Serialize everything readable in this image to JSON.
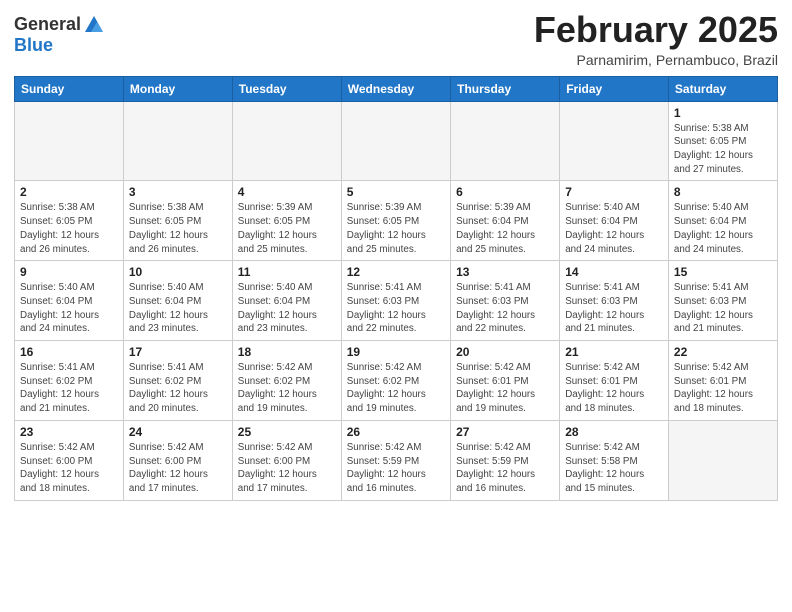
{
  "header": {
    "logo_general": "General",
    "logo_blue": "Blue",
    "month_year": "February 2025",
    "location": "Parnamirim, Pernambuco, Brazil"
  },
  "days_of_week": [
    "Sunday",
    "Monday",
    "Tuesday",
    "Wednesday",
    "Thursday",
    "Friday",
    "Saturday"
  ],
  "weeks": [
    [
      {
        "day": "",
        "info": ""
      },
      {
        "day": "",
        "info": ""
      },
      {
        "day": "",
        "info": ""
      },
      {
        "day": "",
        "info": ""
      },
      {
        "day": "",
        "info": ""
      },
      {
        "day": "",
        "info": ""
      },
      {
        "day": "1",
        "info": "Sunrise: 5:38 AM\nSunset: 6:05 PM\nDaylight: 12 hours\nand 27 minutes."
      }
    ],
    [
      {
        "day": "2",
        "info": "Sunrise: 5:38 AM\nSunset: 6:05 PM\nDaylight: 12 hours\nand 26 minutes."
      },
      {
        "day": "3",
        "info": "Sunrise: 5:38 AM\nSunset: 6:05 PM\nDaylight: 12 hours\nand 26 minutes."
      },
      {
        "day": "4",
        "info": "Sunrise: 5:39 AM\nSunset: 6:05 PM\nDaylight: 12 hours\nand 25 minutes."
      },
      {
        "day": "5",
        "info": "Sunrise: 5:39 AM\nSunset: 6:05 PM\nDaylight: 12 hours\nand 25 minutes."
      },
      {
        "day": "6",
        "info": "Sunrise: 5:39 AM\nSunset: 6:04 PM\nDaylight: 12 hours\nand 25 minutes."
      },
      {
        "day": "7",
        "info": "Sunrise: 5:40 AM\nSunset: 6:04 PM\nDaylight: 12 hours\nand 24 minutes."
      },
      {
        "day": "8",
        "info": "Sunrise: 5:40 AM\nSunset: 6:04 PM\nDaylight: 12 hours\nand 24 minutes."
      }
    ],
    [
      {
        "day": "9",
        "info": "Sunrise: 5:40 AM\nSunset: 6:04 PM\nDaylight: 12 hours\nand 24 minutes."
      },
      {
        "day": "10",
        "info": "Sunrise: 5:40 AM\nSunset: 6:04 PM\nDaylight: 12 hours\nand 23 minutes."
      },
      {
        "day": "11",
        "info": "Sunrise: 5:40 AM\nSunset: 6:04 PM\nDaylight: 12 hours\nand 23 minutes."
      },
      {
        "day": "12",
        "info": "Sunrise: 5:41 AM\nSunset: 6:03 PM\nDaylight: 12 hours\nand 22 minutes."
      },
      {
        "day": "13",
        "info": "Sunrise: 5:41 AM\nSunset: 6:03 PM\nDaylight: 12 hours\nand 22 minutes."
      },
      {
        "day": "14",
        "info": "Sunrise: 5:41 AM\nSunset: 6:03 PM\nDaylight: 12 hours\nand 21 minutes."
      },
      {
        "day": "15",
        "info": "Sunrise: 5:41 AM\nSunset: 6:03 PM\nDaylight: 12 hours\nand 21 minutes."
      }
    ],
    [
      {
        "day": "16",
        "info": "Sunrise: 5:41 AM\nSunset: 6:02 PM\nDaylight: 12 hours\nand 21 minutes."
      },
      {
        "day": "17",
        "info": "Sunrise: 5:41 AM\nSunset: 6:02 PM\nDaylight: 12 hours\nand 20 minutes."
      },
      {
        "day": "18",
        "info": "Sunrise: 5:42 AM\nSunset: 6:02 PM\nDaylight: 12 hours\nand 19 minutes."
      },
      {
        "day": "19",
        "info": "Sunrise: 5:42 AM\nSunset: 6:02 PM\nDaylight: 12 hours\nand 19 minutes."
      },
      {
        "day": "20",
        "info": "Sunrise: 5:42 AM\nSunset: 6:01 PM\nDaylight: 12 hours\nand 19 minutes."
      },
      {
        "day": "21",
        "info": "Sunrise: 5:42 AM\nSunset: 6:01 PM\nDaylight: 12 hours\nand 18 minutes."
      },
      {
        "day": "22",
        "info": "Sunrise: 5:42 AM\nSunset: 6:01 PM\nDaylight: 12 hours\nand 18 minutes."
      }
    ],
    [
      {
        "day": "23",
        "info": "Sunrise: 5:42 AM\nSunset: 6:00 PM\nDaylight: 12 hours\nand 18 minutes."
      },
      {
        "day": "24",
        "info": "Sunrise: 5:42 AM\nSunset: 6:00 PM\nDaylight: 12 hours\nand 17 minutes."
      },
      {
        "day": "25",
        "info": "Sunrise: 5:42 AM\nSunset: 6:00 PM\nDaylight: 12 hours\nand 17 minutes."
      },
      {
        "day": "26",
        "info": "Sunrise: 5:42 AM\nSunset: 5:59 PM\nDaylight: 12 hours\nand 16 minutes."
      },
      {
        "day": "27",
        "info": "Sunrise: 5:42 AM\nSunset: 5:59 PM\nDaylight: 12 hours\nand 16 minutes."
      },
      {
        "day": "28",
        "info": "Sunrise: 5:42 AM\nSunset: 5:58 PM\nDaylight: 12 hours\nand 15 minutes."
      },
      {
        "day": "",
        "info": ""
      }
    ]
  ]
}
